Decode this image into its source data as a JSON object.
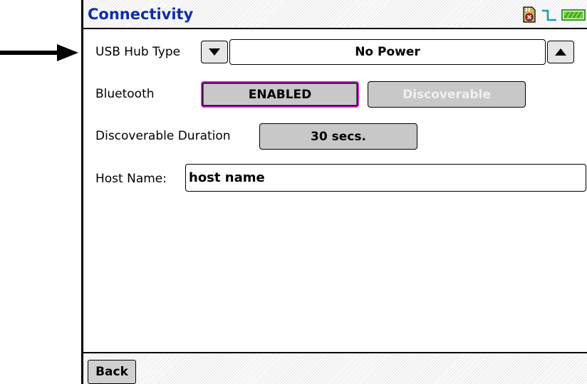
{
  "title": "Connectivity",
  "status_icons": [
    "sd-card-error-icon",
    "signal-pulse-icon",
    "battery-icon"
  ],
  "usb_hub": {
    "label": "USB Hub Type",
    "value": "No Power"
  },
  "bluetooth": {
    "label": "Bluetooth",
    "enabled_label": "ENABLED",
    "discoverable_label": "Discoverable"
  },
  "discoverable_duration": {
    "label": "Discoverable Duration",
    "value": "30 secs."
  },
  "host_name": {
    "label": "Host Name:",
    "value": "host name"
  },
  "footer": {
    "back_label": "Back"
  },
  "colors": {
    "title": "#0d2fa6",
    "focus_border": "#d21fd6",
    "disabled_text": "#f0f0f0",
    "button_bg": "#c8c8c8"
  }
}
